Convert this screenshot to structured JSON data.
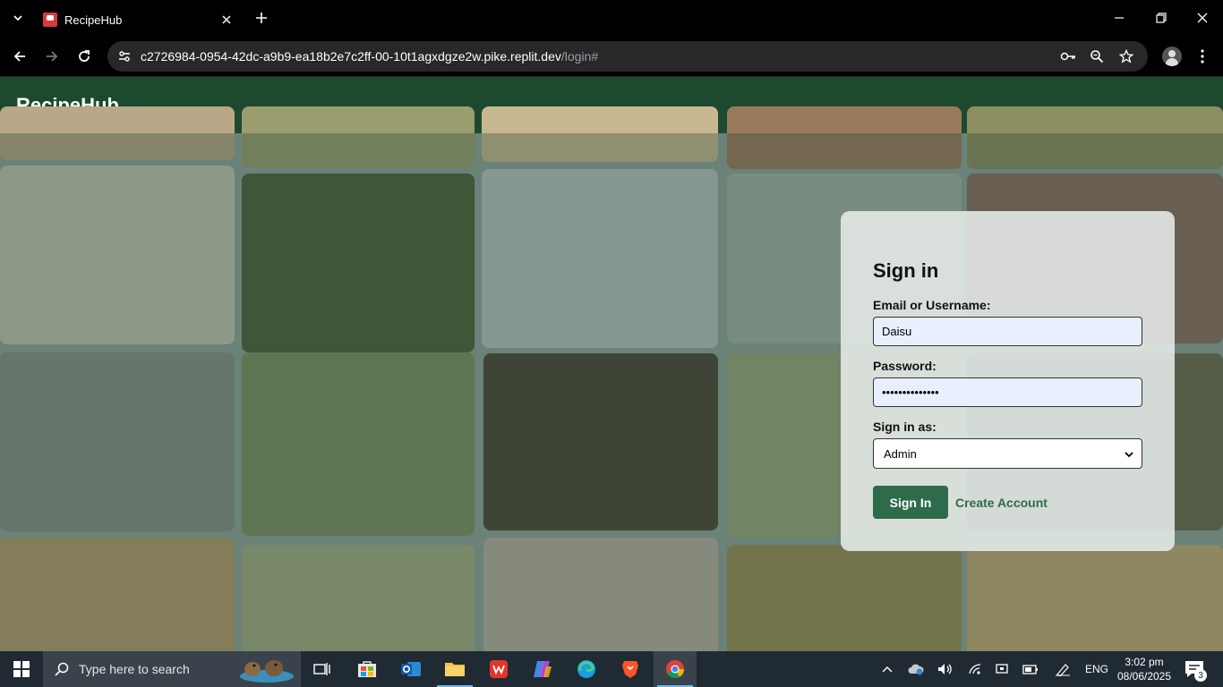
{
  "browser": {
    "tab_title": "RecipeHub",
    "url_host": "c2726984-0954-42dc-a9b9-ea18b2e7c2ff-00-10t1agxdgze2w.pike.replit.dev",
    "url_path": "/login#"
  },
  "site": {
    "brand": "RecipeHub"
  },
  "login": {
    "title": "Sign in",
    "email_label": "Email or Username:",
    "email_value": "Daisu",
    "password_label": "Password:",
    "password_value": "••••••••••••••",
    "role_label": "Sign in as:",
    "role_selected": "Admin",
    "signin_button": "Sign In",
    "create_account_link": "Create Account"
  },
  "colors": {
    "header_green": "#1d4a2f",
    "button_green": "#2e6b4b",
    "input_fill": "#e8f0fe"
  },
  "taskbar": {
    "search_placeholder": "Type here to search",
    "language": "ENG",
    "time": "3:02 pm",
    "date": "08/06/2025",
    "notification_count": "3"
  }
}
